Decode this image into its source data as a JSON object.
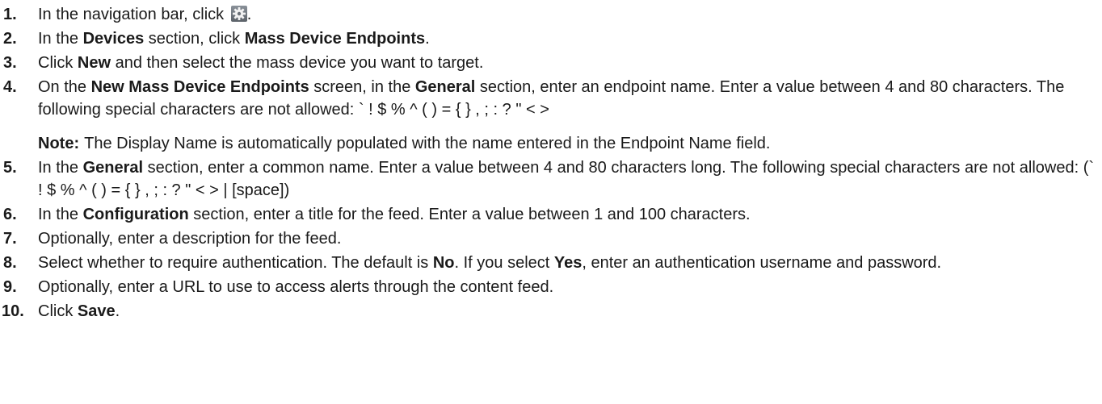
{
  "steps": [
    {
      "num": "1.",
      "segments": [
        {
          "text": "In the navigation bar, click ",
          "bold": false
        },
        {
          "icon": "gear-icon"
        },
        {
          "text": ".",
          "bold": false
        }
      ]
    },
    {
      "num": "2.",
      "segments": [
        {
          "text": "In the ",
          "bold": false
        },
        {
          "text": "Devices",
          "bold": true
        },
        {
          "text": " section, click ",
          "bold": false
        },
        {
          "text": "Mass Device Endpoints",
          "bold": true
        },
        {
          "text": ".",
          "bold": false
        }
      ]
    },
    {
      "num": "3.",
      "segments": [
        {
          "text": "Click ",
          "bold": false
        },
        {
          "text": "New",
          "bold": true
        },
        {
          "text": " and then select the mass device you want to target.",
          "bold": false
        }
      ]
    },
    {
      "num": "4.",
      "segments": [
        {
          "text": "On the ",
          "bold": false
        },
        {
          "text": "New Mass Device Endpoints",
          "bold": true
        },
        {
          "text": " screen, in the ",
          "bold": false
        },
        {
          "text": "General",
          "bold": true
        },
        {
          "text": " section, enter an endpoint name. Enter a value between 4 and 80 characters. The following special characters are not allowed: ` ! $ % ^ ( ) = { } , ; : ? \" < >",
          "bold": false
        }
      ],
      "note": {
        "label": "Note:",
        "text": "The Display Name is automatically populated with the name entered in the Endpoint Name field."
      }
    },
    {
      "num": "5.",
      "segments": [
        {
          "text": "In the ",
          "bold": false
        },
        {
          "text": "General",
          "bold": true
        },
        {
          "text": " section, enter a common name. Enter a value between 4 and 80 characters long. The following special characters are not allowed: (` ! $ % ^ ( ) = { } , ; : ? \" < > | [space])",
          "bold": false
        }
      ]
    },
    {
      "num": "6.",
      "segments": [
        {
          "text": "In the ",
          "bold": false
        },
        {
          "text": "Configuration",
          "bold": true
        },
        {
          "text": " section, enter a title for the feed. Enter a value between 1 and 100 characters.",
          "bold": false
        }
      ]
    },
    {
      "num": "7.",
      "segments": [
        {
          "text": "Optionally, enter a description for the feed.",
          "bold": false
        }
      ]
    },
    {
      "num": "8.",
      "segments": [
        {
          "text": "Select whether to require authentication. The default is ",
          "bold": false
        },
        {
          "text": "No",
          "bold": true
        },
        {
          "text": ". If you select ",
          "bold": false
        },
        {
          "text": "Yes",
          "bold": true
        },
        {
          "text": ", enter an authentication username and password.",
          "bold": false
        }
      ]
    },
    {
      "num": "9.",
      "segments": [
        {
          "text": "Optionally, enter a URL to use to access alerts through the content feed.",
          "bold": false
        }
      ]
    },
    {
      "num": "10.",
      "segments": [
        {
          "text": "Click ",
          "bold": false
        },
        {
          "text": "Save",
          "bold": true
        },
        {
          "text": ".",
          "bold": false
        }
      ]
    }
  ]
}
